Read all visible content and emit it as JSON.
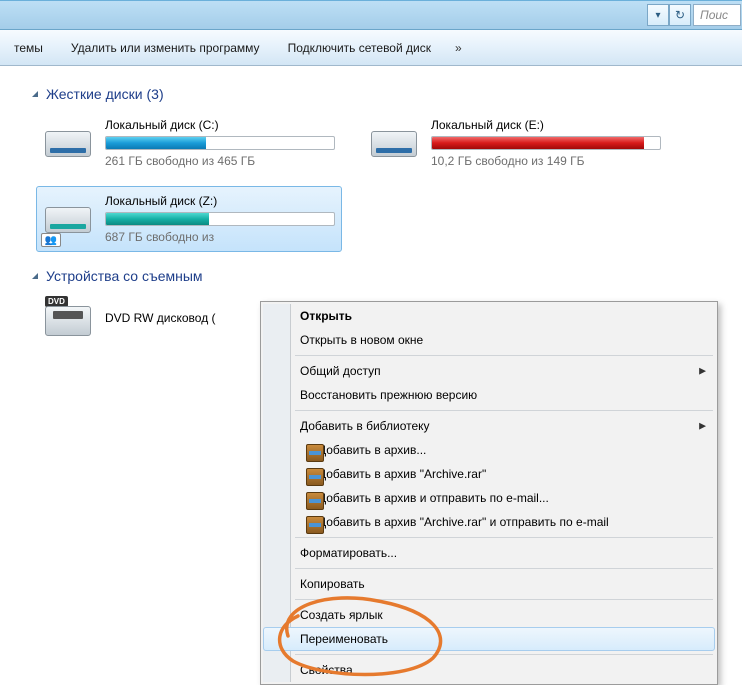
{
  "addressbar": {
    "search_placeholder": "Поис"
  },
  "toolbar": {
    "items": [
      "темы",
      "Удалить или изменить программу",
      "Подключить сетевой диск"
    ],
    "overflow": "»"
  },
  "groups": {
    "hdd": {
      "title": "Жесткие диски",
      "count": "(3)"
    },
    "removable": {
      "title": "Устройства со съемным"
    }
  },
  "drives": {
    "c": {
      "name": "Локальный диск (C:)",
      "status": "261 ГБ свободно из 465 ГБ",
      "fill_pct": 44
    },
    "e": {
      "name": "Локальный диск (E:)",
      "status": "10,2 ГБ свободно из 149 ГБ",
      "fill_pct": 93
    },
    "z": {
      "name": "Локальный диск (Z:)",
      "status": "687 ГБ свободно из",
      "fill_pct": 45
    },
    "dvd": {
      "name": "DVD RW дисковод ("
    }
  },
  "context_menu": {
    "open": "Открыть",
    "open_new": "Открыть в новом окне",
    "share": "Общий доступ",
    "restore": "Восстановить прежнюю версию",
    "add_library": "Добавить в библиотеку",
    "add_archive": "Добавить в архив...",
    "add_archive_named": "Добавить в архив \"Archive.rar\"",
    "add_archive_email": "Добавить в архив и отправить по e-mail...",
    "add_archive_named_email": "Добавить в архив \"Archive.rar\" и отправить по e-mail",
    "format": "Форматировать...",
    "copy": "Копировать",
    "create_shortcut": "Создать ярлык",
    "rename": "Переименовать",
    "properties": "Свойства"
  }
}
